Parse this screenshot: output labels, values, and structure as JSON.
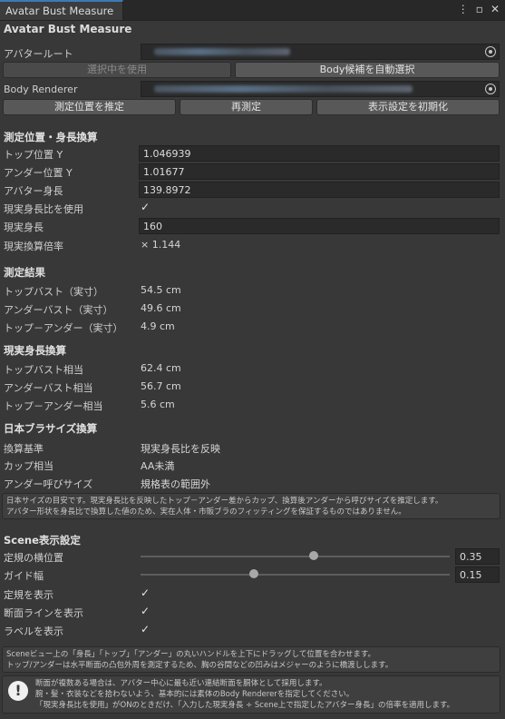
{
  "tab": {
    "title": "Avatar Bust Measure",
    "menu_icon": "kebab-menu-icon",
    "maximize_icon": "maximize-icon",
    "close_icon": "close-icon"
  },
  "header": {
    "title": "Avatar Bust Measure"
  },
  "avatar_root": {
    "label": "アバタールート",
    "value": "",
    "use_selected_label": "選択中を使用",
    "auto_select_label": "Body候補を自動選択"
  },
  "body_renderer": {
    "label": "Body Renderer",
    "value": ""
  },
  "buttons": {
    "estimate": "測定位置を推定",
    "remeasure": "再測定",
    "reset_display": "表示設定を初期化"
  },
  "position_section": {
    "title": "測定位置・身長換算",
    "top_y_label": "トップ位置 Y",
    "top_y_value": "1.046939",
    "under_y_label": "アンダー位置 Y",
    "under_y_value": "1.01677",
    "avatar_height_label": "アバター身長",
    "avatar_height_value": "139.8972",
    "use_real_ratio_label": "現実身長比を使用",
    "use_real_ratio_checked": true,
    "real_height_label": "現実身長",
    "real_height_value": "160",
    "ratio_label": "現実換算倍率",
    "ratio_value": "× 1.144"
  },
  "result_section": {
    "title": "測定結果",
    "top_bust_label": "トップバスト（実寸）",
    "top_bust_value": "54.5 cm",
    "under_bust_label": "アンダーバスト（実寸）",
    "under_bust_value": "49.6 cm",
    "diff_label": "トップ－アンダー（実寸）",
    "diff_value": "4.9 cm"
  },
  "real_section": {
    "title": "現実身長換算",
    "top_label": "トップバスト相当",
    "top_value": "62.4 cm",
    "under_label": "アンダーバスト相当",
    "under_value": "56.7 cm",
    "diff_label": "トップ－アンダー相当",
    "diff_value": "5.6 cm"
  },
  "jp_size_section": {
    "title": "日本ブラサイズ換算",
    "basis_label": "換算基準",
    "basis_value": "現実身長比を反映",
    "cup_label": "カップ相当",
    "cup_value": "AA未満",
    "under_call_label": "アンダー呼びサイズ",
    "under_call_value": "規格表の範囲外",
    "help_line1": "日本サイズの目安です。現実身長比を反映したトップ－アンダー差からカップ、換算後アンダーから呼びサイズを推定します。",
    "help_line2": "アバター形状を身長比で換算した値のため、実在人体・市販ブラのフィッティングを保証するものではありません。"
  },
  "scene_section": {
    "title": "Scene表示設定",
    "ruler_pos_label": "定規の横位置",
    "ruler_pos_value": "0.35",
    "ruler_pos_level": 0.35,
    "guide_width_label": "ガイド幅",
    "guide_width_value": "0.15",
    "guide_width_level": 0.15,
    "show_ruler_label": "定規を表示",
    "show_ruler_checked": true,
    "show_section_label": "断面ラインを表示",
    "show_section_checked": true,
    "show_labels_label": "ラベルを表示",
    "show_labels_checked": true,
    "check_glyph": "✓"
  },
  "help_scene": {
    "line1": "Sceneビュー上の「身長」「トップ」「アンダー」の丸いハンドルを上下にドラッグして位置を合わせます。",
    "line2": "トップ/アンダーは水平断面の凸包外周を測定するため、胸の谷間などの凹みはメジャーのように橋渡しします。"
  },
  "warning": {
    "icon": "warning-icon",
    "glyph": "!",
    "line1": "断面が複数ある場合は、アバター中心に最も近い連結断面を胴体として採用します。",
    "line2": "腕・髪・衣装などを拾わないよう、基本的には素体のBody Rendererを指定してください。",
    "line3": "「現実身長比を使用」がONのときだけ、「入力した現実身長 ÷ Scene上で指定したアバター身長」の倍率を適用します。"
  }
}
